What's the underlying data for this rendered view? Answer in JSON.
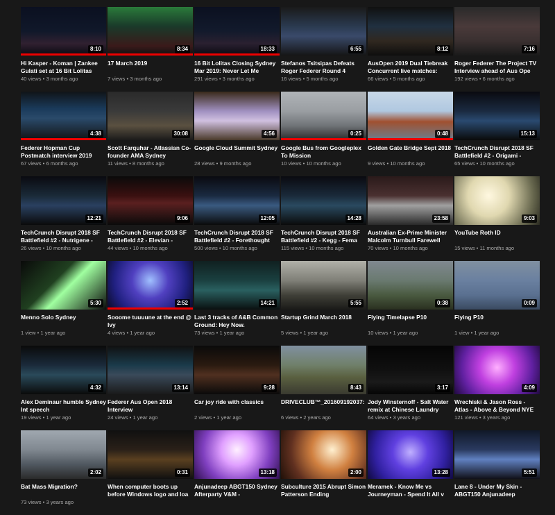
{
  "videos": [
    {
      "title": "Hi Kasper - Koman | Zankee Gulati set at 16 Bit Lolitas",
      "views": "40 views",
      "age": "3 months ago",
      "duration": "8:10",
      "progress": 1.0,
      "bg": "linear-gradient(180deg,#0b1020 0%,#10182a 50%,#302030 75%,#0a0a12 100%)"
    },
    {
      "title": "17 March 2019",
      "views": "7 views",
      "age": "3 months ago",
      "duration": "8:34",
      "progress": 1.0,
      "bg": "linear-gradient(180deg,#2a7a3a 0%,#1a3a2a 40%,#3a1a1a 80%,#111 100%)"
    },
    {
      "title": "16 Bit Lolitas Closing Sydney Mar 2019: Never Let Me",
      "views": "291 views",
      "age": "3 months ago",
      "duration": "18:33",
      "progress": 1.0,
      "bg": "linear-gradient(180deg,#0b1020 0%,#121a2c 50%,#2a2030 75%,#0a0a12 100%)"
    },
    {
      "title": "Stefanos Tsitsipas Defeats Roger Federer Round 4",
      "views": "16 views",
      "age": "5 months ago",
      "duration": "6:55",
      "progress": 0.0,
      "bg": "linear-gradient(180deg,#1a1a1a 0%,#2a3a50 40%,#3a4a6a 60%,#151515 100%)"
    },
    {
      "title": "AusOpen 2019 Dual Tiebreak Concurrent live matches:",
      "views": "66 views",
      "age": "5 months ago",
      "duration": "8:12",
      "progress": 0.0,
      "bg": "linear-gradient(180deg,#101010 0%,#203040 40%,#302820 70%,#0e0e0e 100%)"
    },
    {
      "title": "Roger Federer The Project TV Interview ahead of Aus Ope",
      "views": "192 views",
      "age": "6 months ago",
      "duration": "7:16",
      "progress": 0.0,
      "bg": "linear-gradient(180deg,#2a2a2a 0%,#4a3a3a 40%,#3a3030 70%,#1a1a1a 100%)"
    },
    {
      "title": "Federer Hopman Cup Postmatch interview 2019",
      "views": "67 views",
      "age": "6 months ago",
      "duration": "4:38",
      "progress": 1.0,
      "bg": "linear-gradient(180deg,#101418 0%,#1a3a5a 35%,#2a4a6a 55%,#121212 100%)"
    },
    {
      "title": "Scott Farquhar - Atlassian Co-founder AMA Sydney",
      "views": "11 views",
      "age": "8 months ago",
      "duration": "30:08",
      "progress": 0.0,
      "bg": "linear-gradient(180deg,#2a2a2a 0%,#3a3a3a 40%,#5a5040 70%,#1a1a1a 100%)"
    },
    {
      "title": "Google Cloud Summit Sydney",
      "views": "28 views",
      "age": "9 months ago",
      "duration": "4:56",
      "progress": 0.0,
      "bg": "linear-gradient(180deg,#3a2a1a 0%,#a090c0 40%,#d0c0e0 60%,#4a3a2a 100%)"
    },
    {
      "title": "Google Bus from Googleplex To Mission",
      "views": "10 views",
      "age": "10 months ago",
      "duration": "0:25",
      "progress": 1.0,
      "bg": "linear-gradient(180deg,#b0b4b8 0%,#9a9ea2 40%,#707478 70%,#2a2a2a 100%)"
    },
    {
      "title": "Golden Gate Bridge Sept 2018",
      "views": "9 views",
      "age": "10 months ago",
      "duration": "0:48",
      "progress": 1.0,
      "bg": "linear-gradient(180deg,#c8d8e8 0%,#b0c8e0 40%,#a05030 62%,#6a8090 100%)"
    },
    {
      "title": "TechCrunch Disrupt 2018 SF Battlefield #2 - Origami -",
      "views": "65 views",
      "age": "10 months ago",
      "duration": "15:13",
      "progress": 0.0,
      "bg": "linear-gradient(180deg,#0a0a10 0%,#1a2a40 40%,#2a4a70 60%,#0a0a0a 100%)"
    },
    {
      "title": "TechCrunch Disrupt 2018 SF Battlefield #2 - Nutrigene -",
      "views": "26 views",
      "age": "10 months ago",
      "duration": "12:21",
      "progress": 0.0,
      "bg": "linear-gradient(180deg,#0a0a10 0%,#1a2a38 40%,#2a4060 60%,#0a0a0a 100%)"
    },
    {
      "title": "TechCrunch Disrupt 2018 SF Battlefield #2 - Elevian -",
      "views": "44 views",
      "age": "10 months ago",
      "duration": "9:06",
      "progress": 0.0,
      "bg": "linear-gradient(180deg,#0a0a0a 0%,#3a1010 40%,#5a2020 55%,#0a0a0a 100%)"
    },
    {
      "title": "TechCrunch Disrupt 2018 SF Battlefield #2 - Forethought",
      "views": "500 views",
      "age": "10 months ago",
      "duration": "12:05",
      "progress": 0.0,
      "bg": "linear-gradient(180deg,#0a0a10 0%,#1a2a40 40%,#3a5a80 60%,#0a0a0a 100%)"
    },
    {
      "title": "TechCrunch Disrupt 2018 SF Battlefield #2 - Kegg - Fema",
      "views": "115 views",
      "age": "10 months ago",
      "duration": "14:28",
      "progress": 0.0,
      "bg": "linear-gradient(180deg,#0a0a10 0%,#1a2a3a 40%,#2a4a60 60%,#0a0a0a 100%)"
    },
    {
      "title": "Australian Ex-Prime Minister Malcolm Turnbull Farewell",
      "views": "70 views",
      "age": "10 months ago",
      "duration": "23:58",
      "progress": 0.0,
      "bg": "linear-gradient(180deg,#2a1a1a 0%,#4a3030 40%,#a0a0a0 60%,#2a2a2a 100%)"
    },
    {
      "title": "YouTube Roth ID",
      "views": "15 views",
      "age": "11 months ago",
      "duration": "9:03",
      "progress": 0.0,
      "bg": "radial-gradient(circle at 40% 40%,#fff8e0 0%,#e0d8b0 35%,#6a6a50 75%,#2a2a20 100%)"
    },
    {
      "title": "Menno Solo Sydney",
      "views": "1 view",
      "age": "1 year ago",
      "duration": "5:30",
      "progress": 0.0,
      "bg": "linear-gradient(135deg,#0a0a0a 0%,#204020 40%,#a0ffa0 55%,#0a0a0a 100%)"
    },
    {
      "title": "Sooome tuuuune at the end @ Ivy",
      "views": "4 views",
      "age": "1 year ago",
      "duration": "2:52",
      "progress": 1.0,
      "bg": "radial-gradient(circle at 50% 40%,#a0c0ff 0%,#5040c0 35%,#202080 70%,#0a0a20 100%)"
    },
    {
      "title": "Last 3 tracks of A&B Common Ground: Hey Now.",
      "views": "73 views",
      "age": "1 year ago",
      "duration": "14:21",
      "progress": 0.0,
      "bg": "linear-gradient(180deg,#102020 0%,#1a4040 40%,#2a6060 60%,#0a1010 100%)"
    },
    {
      "title": "Startup Grind March 2018",
      "views": "5 views",
      "age": "1 year ago",
      "duration": "5:55",
      "progress": 0.0,
      "bg": "linear-gradient(180deg,#b0b0a8 0%,#808078 40%,#404038 70%,#1a1a18 100%)"
    },
    {
      "title": "Flying Timelapse P10",
      "views": "10 views",
      "age": "1 year ago",
      "duration": "0:38",
      "progress": 0.0,
      "bg": "linear-gradient(180deg,#808890 0%,#6a7a70 40%,#4a5a40 70%,#2a3020 100%)"
    },
    {
      "title": "Flying P10",
      "views": "1 view",
      "age": "1 year ago",
      "duration": "0:09",
      "progress": 0.0,
      "bg": "linear-gradient(180deg,#8090a0 0%,#6a80a0 40%,#5a7090 70%,#3a4a60 100%)"
    },
    {
      "title": "Alex Deminaur humble Sydney Int speech",
      "views": "19 views",
      "age": "1 year ago",
      "duration": "4:32",
      "progress": 0.0,
      "bg": "linear-gradient(180deg,#0a0a0a 0%,#1a2a3a 40%,#2a4a5a 60%,#0a0a0a 100%)"
    },
    {
      "title": "Federer Aus Open 2018 Interview",
      "views": "24 views",
      "age": "1 year ago",
      "duration": "13:14",
      "progress": 0.0,
      "bg": "linear-gradient(180deg,#101010 0%,#1a3a4a 40%,#3a4a5a 60%,#1a1a1a 100%)"
    },
    {
      "title": "Car joy ride with classics",
      "views": "2 views",
      "age": "1 year ago",
      "duration": "9:28",
      "progress": 0.0,
      "bg": "linear-gradient(180deg,#0a0a0a 0%,#2a1a10 40%,#503020 60%,#0a0a0a 100%)"
    },
    {
      "title": "DRIVECLUB™_20160919203​7:",
      "views": "6 views",
      "age": "2 years ago",
      "duration": "8:43",
      "progress": 0.0,
      "bg": "linear-gradient(180deg,#8090a0 0%,#70806a 40%,#5a6040 65%,#3a3a30 100%)"
    },
    {
      "title": "Jody Winsternoff - Salt Water remix at Chinese Laundry",
      "views": "64 views",
      "age": "3 years ago",
      "duration": "3:17",
      "progress": 0.0,
      "bg": "linear-gradient(180deg,#050505 0%,#101010 50%,#1a1a1a 75%,#050505 100%)"
    },
    {
      "title": "Wrechiski & Jason Ross - Atlas - Above & Beyond NYE",
      "views": "121 views",
      "age": "3 years ago",
      "duration": "4:09",
      "progress": 0.0,
      "bg": "radial-gradient(circle at 50% 45%,#ffb0ff 0%,#c040e0 35%,#6020a0 70%,#200a40 100%)"
    },
    {
      "title": "Bat Mass Migration?",
      "views": "73 views",
      "age": "3 years ago",
      "duration": "2:02",
      "progress": 0.0,
      "bg": "linear-gradient(180deg,#a0a8b0 0%,#808890 40%,#505860 70%,#2a2a2a 100%)"
    },
    {
      "title": "When computer boots up before Windows logo and loa",
      "views": "",
      "age": "",
      "duration": "0:31",
      "progress": 0.0,
      "bg": "linear-gradient(180deg,#101010 0%,#2a2018 40%,#5a4020 60%,#101010 100%)"
    },
    {
      "title": "Anjunadeep ABGT150 Sydney Afterparty V&M -",
      "views": "",
      "age": "",
      "duration": "13:18",
      "progress": 0.0,
      "bg": "radial-gradient(circle at 50% 40%,#fff0ff 0%,#e0a0ff 30%,#8040c0 65%,#301050 100%)"
    },
    {
      "title": "Subculture 2015 Abrupt Simon Patterson Ending",
      "views": "",
      "age": "",
      "duration": "2:00",
      "progress": 0.0,
      "bg": "radial-gradient(circle at 60% 40%,#fff0d0 0%,#d08040 35%,#603020 70%,#201008 100%)"
    },
    {
      "title": "Meramek - Know Me vs Journeyman - Spend It All v",
      "views": "",
      "age": "",
      "duration": "13:28",
      "progress": 0.0,
      "bg": "radial-gradient(circle at 50% 45%,#c0b0ff 0%,#6040e0 35%,#3020a0 70%,#100a40 100%)"
    },
    {
      "title": "Lane 8 - Under My Skin - ABGT150 Anjunadeep",
      "views": "",
      "age": "",
      "duration": "5:51",
      "progress": 0.0,
      "bg": "linear-gradient(180deg,#101828 0%,#2a3a60 40%,#6080c0 60%,#101018 100%)"
    }
  ]
}
